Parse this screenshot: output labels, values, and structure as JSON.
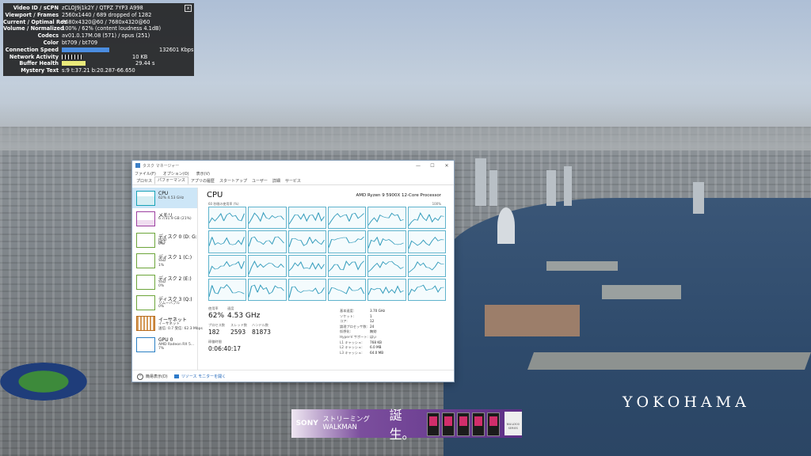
{
  "stats_overlay": {
    "close_label": "x",
    "rows": [
      {
        "key": "Video ID / sCPN",
        "value": "zCLOJ9j1k2Y / QTPZ 7YP3 A998"
      },
      {
        "key": "Viewport / Frames",
        "value": "2560x1440 / 689 dropped of 1282"
      },
      {
        "key": "Current / Optimal Res",
        "value": "7680x4320@60 / 7680x4320@60"
      },
      {
        "key": "Volume / Normalized",
        "value": "100% / 62% (content loudness 4.1dB)"
      },
      {
        "key": "Codecs",
        "value": "av01.0.17M.08 (571) / opus (251)"
      },
      {
        "key": "Color",
        "value": "bt709 / bt709"
      },
      {
        "key": "Connection Speed",
        "value": "132601 Kbps"
      },
      {
        "key": "Network Activity",
        "value": "10 KB"
      },
      {
        "key": "Buffer Health",
        "value": "29.44 s"
      },
      {
        "key": "Mystery Text",
        "value": "s:9 t:37.21 b:20.287-66.650"
      }
    ]
  },
  "task_manager": {
    "title": "タスク マネージャー",
    "window_controls": {
      "minimize": "—",
      "maximize": "☐",
      "close": "✕"
    },
    "menu": [
      "ファイル(F)",
      "オプション(O)",
      "表示(V)"
    ],
    "tabs": [
      "プロセス",
      "パフォーマンス",
      "アプリの履歴",
      "スタートアップ",
      "ユーザー",
      "詳細",
      "サービス"
    ],
    "active_tab": 1,
    "sidebar": [
      {
        "name": "CPU",
        "sub": "62% 4.53 GHz",
        "sub2": "",
        "kind": "cpu"
      },
      {
        "name": "メモリ",
        "sub": "6.7/31.9 GB (21%)",
        "sub2": "",
        "kind": "mem"
      },
      {
        "name": "ディスク 0 (D: G: H:)",
        "sub": "HDD",
        "sub2": "0%",
        "kind": "disk"
      },
      {
        "name": "ディスク 1 (C:)",
        "sub": "SSD",
        "sub2": "1%",
        "kind": "disk"
      },
      {
        "name": "ディスク 2 (E:)",
        "sub": "SSD",
        "sub2": "0%",
        "kind": "disk"
      },
      {
        "name": "ディスク 3 (Q:)",
        "sub": "リムーバブル",
        "sub2": "0%",
        "kind": "disk"
      },
      {
        "name": "イーサネット",
        "sub": "イーサネット",
        "sub2": "送信: 0.7 受信: 62.3 Mbps",
        "kind": "net"
      },
      {
        "name": "GPU 0",
        "sub": "AMD Radeon RX 5...",
        "sub2": "7%",
        "kind": "gpu"
      }
    ],
    "main": {
      "title": "CPU",
      "processor": "AMD Ryzen 9 5900X 12-Core Processor",
      "graph_label": "60 秒間の使用率 (%)",
      "graph_max": "100%",
      "stats": {
        "usage_label": "使用率",
        "usage": "62%",
        "speed_label": "速度",
        "speed": "4.53 GHz",
        "processes_label": "プロセス数",
        "processes": "182",
        "threads_label": "スレッド数",
        "threads": "2593",
        "handles_label": "ハンドル数",
        "handles": "81873",
        "uptime_label": "稼働時間",
        "uptime": "0:06:40:17"
      },
      "specs": [
        {
          "k": "基本速度:",
          "v": "3.70 GHz"
        },
        {
          "k": "ソケット:",
          "v": "1"
        },
        {
          "k": "コア:",
          "v": "12"
        },
        {
          "k": "論理プロセッサ数:",
          "v": "24"
        },
        {
          "k": "仮想化:",
          "v": "無効"
        },
        {
          "k": "Hyper-V サポート:",
          "v": "はい"
        },
        {
          "k": "L1 キャッシュ:",
          "v": "768 KB"
        },
        {
          "k": "L2 キャッシュ:",
          "v": "6.0 MB"
        },
        {
          "k": "L3 キャッシュ:",
          "v": "64.0 MB"
        }
      ]
    },
    "footer": {
      "fewer_details": "簡易表示(D)",
      "resource_monitor": "リソース モニターを開く"
    }
  },
  "watermark": "YOKOHAMA",
  "ad": {
    "brand": "SONY",
    "line1": "ストリーミング",
    "line2": "WALKMAN",
    "headline": "誕生。",
    "badge": "NW-A300 SERIES"
  }
}
